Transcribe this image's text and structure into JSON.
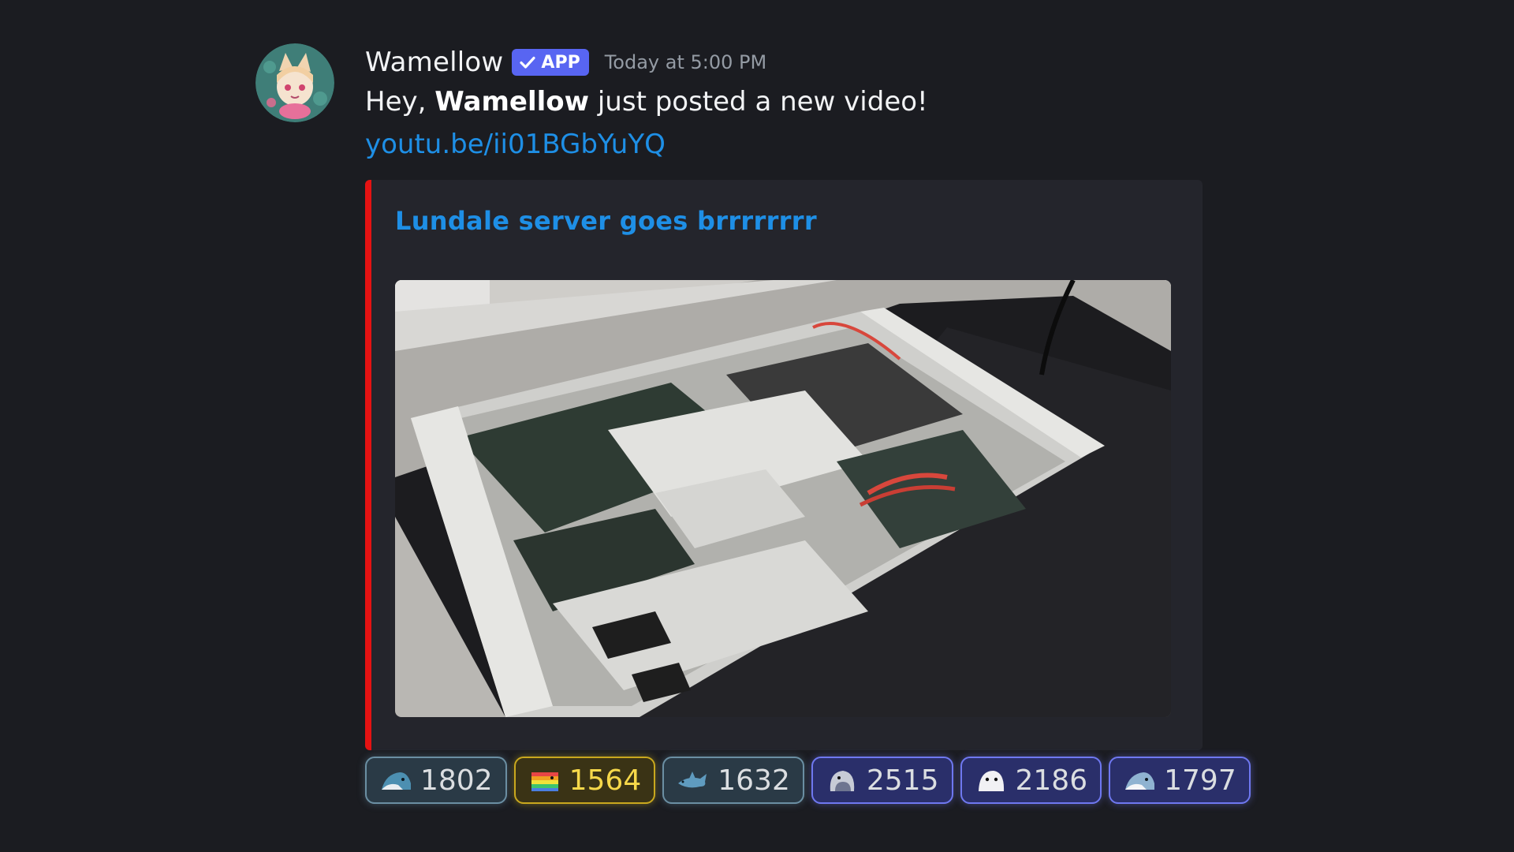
{
  "message": {
    "author": "Wamellow",
    "badge": "APP",
    "timestamp": "Today at 5:00 PM",
    "text_prefix": "Hey, ",
    "text_bold": "Wamellow",
    "text_suffix": " just posted a new video!",
    "link": "youtu.be/ii01BGbYuYQ"
  },
  "embed": {
    "title": "Lundale server goes brrrrrrrr",
    "accent_color": "#e51212"
  },
  "reactions": [
    {
      "count": "1802",
      "emoji": "teal-shark-icon"
    },
    {
      "count": "1564",
      "emoji": "rainbow-shark-icon"
    },
    {
      "count": "1632",
      "emoji": "blue-shark-icon"
    },
    {
      "count": "2515",
      "emoji": "gray-blob-icon"
    },
    {
      "count": "2186",
      "emoji": "white-blob-icon"
    },
    {
      "count": "1797",
      "emoji": "shark-icon"
    }
  ]
}
